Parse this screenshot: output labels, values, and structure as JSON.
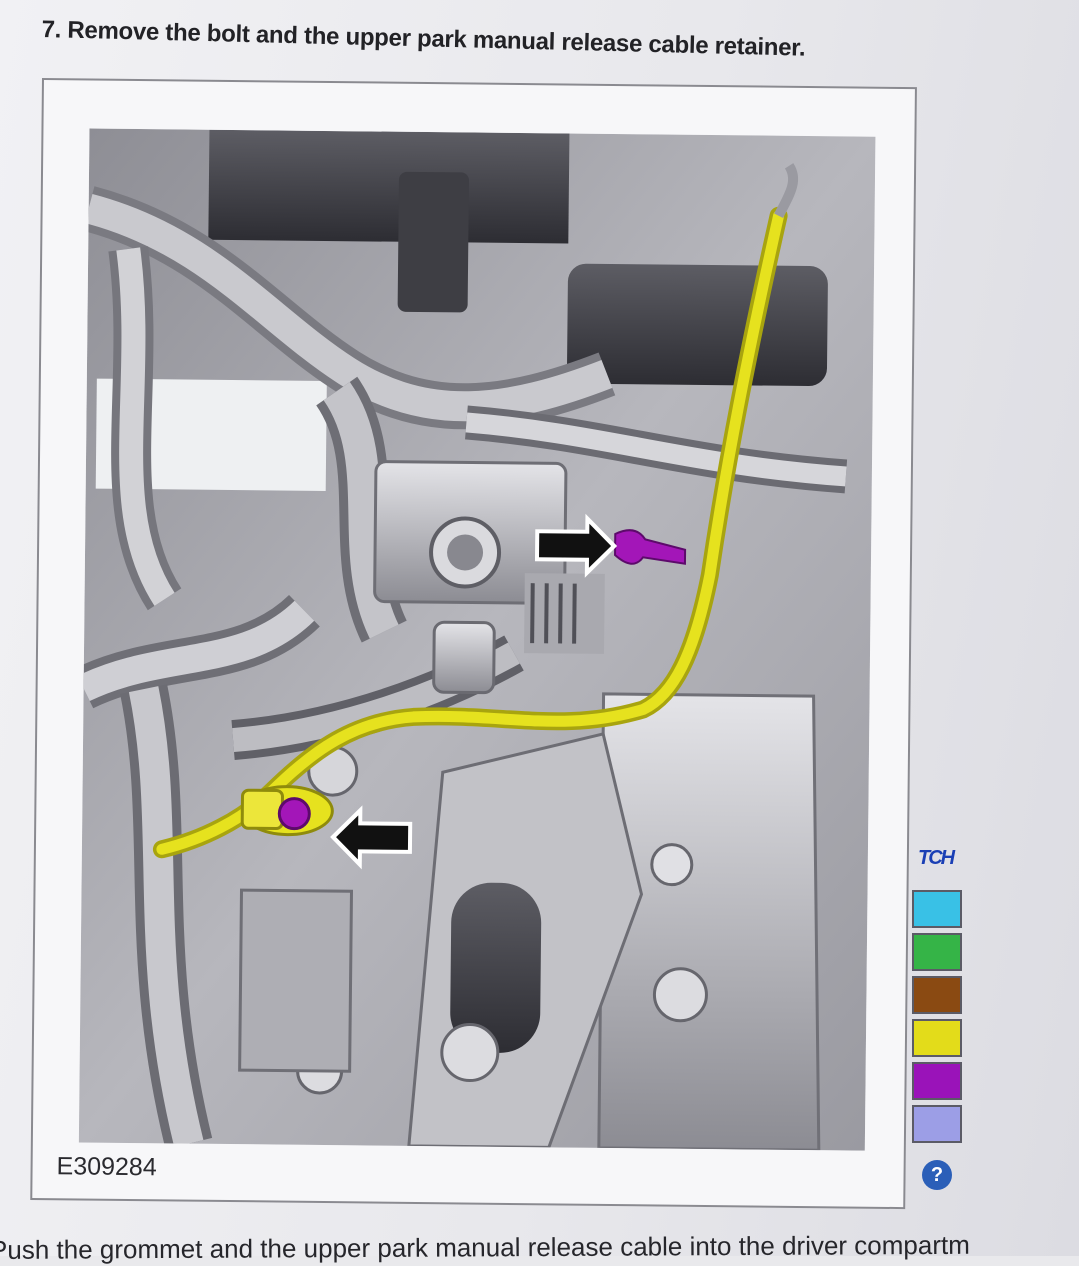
{
  "step": {
    "title": "7. Remove the bolt and the upper park manual release cable retainer."
  },
  "figure": {
    "id_label": "E309284"
  },
  "legend": {
    "tool_icon": "TCH",
    "swatch_colors": [
      "#39c1e6",
      "#35b447",
      "#8a4a12",
      "#e3dc1a",
      "#9a13b9",
      "#9c9ee6"
    ],
    "help_label": "?"
  },
  "next_step": {
    "text": "Push the grommet and the upper park manual release cable into the driver compartm"
  },
  "colors": {
    "cable": "#e6e21e",
    "bolt": "#a316b8",
    "arrow": "#111111"
  }
}
